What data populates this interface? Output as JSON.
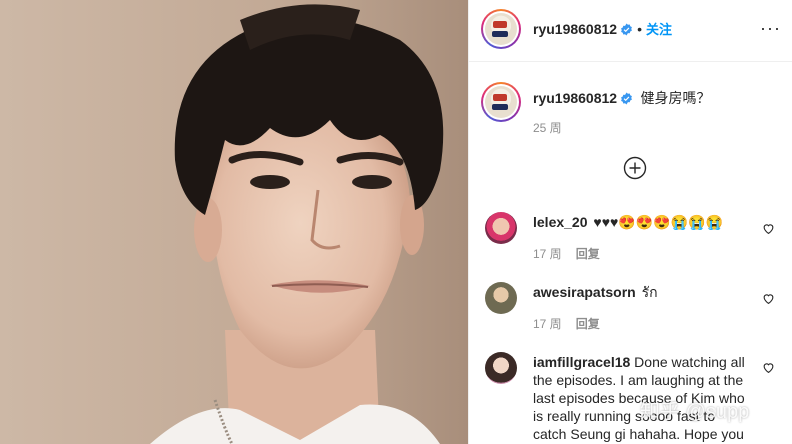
{
  "post": {
    "image_alt": "selfie photo"
  },
  "header": {
    "username": "ryu19860812",
    "separator": "•",
    "follow_label": "关注",
    "more_label": "···"
  },
  "caption": {
    "username": "ryu19860812",
    "text": "健身房嗎？",
    "time": "25 周"
  },
  "comments": [
    {
      "username": "lelex_20",
      "text": "♥♥♥😍😍😍😭😭😭",
      "time": "17 周",
      "reply_label": "回复"
    },
    {
      "username": "awesirapatsorn",
      "text": "รัก",
      "time": "17 周",
      "reply_label": "回复"
    },
    {
      "username": "iamfillgracel18",
      "lines": [
        "Done watching all",
        "the episodes. I am laughing at the",
        "last episodes because of Kim who",
        "is really running soooo fast to",
        "catch Seung gi hahaha. Hope you"
      ]
    }
  ],
  "watermark": "知乎 @supp",
  "colors": {
    "verified_blue": "#3897f0",
    "follow_blue": "#0095f6",
    "muted": "#8e8e8e"
  },
  "icons": {
    "verified": "verified-badge-icon",
    "heart": "heart-outline-icon",
    "load_more": "plus-circle-icon",
    "more": "more-options-icon"
  }
}
